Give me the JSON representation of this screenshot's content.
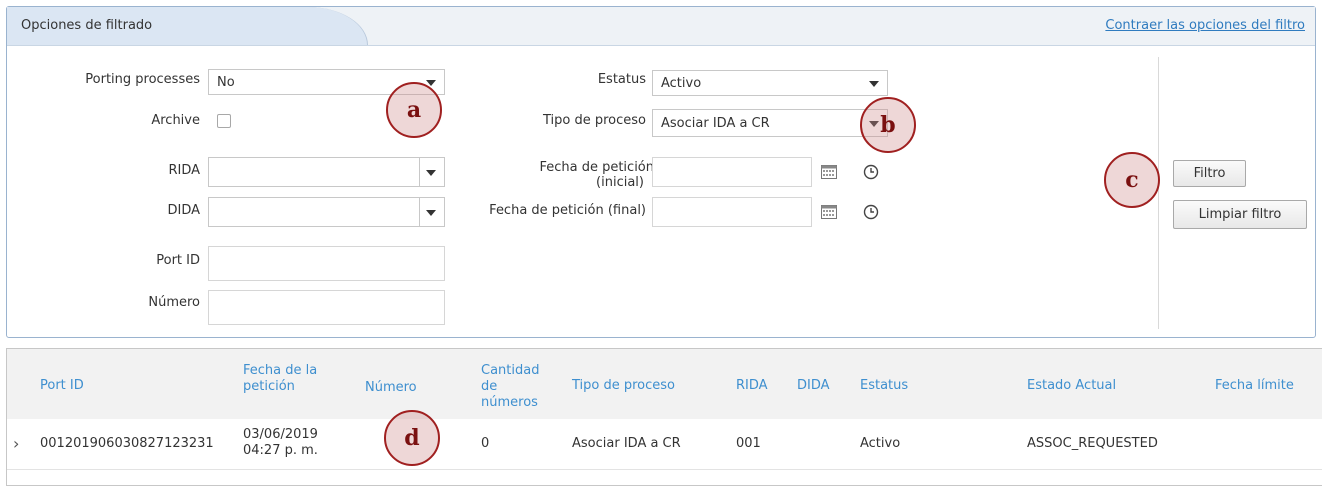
{
  "filter": {
    "title": "Opciones de filtrado",
    "collapse_link": "Contraer las opciones del filtro",
    "porting_processes": {
      "label": "Porting processes",
      "value": "No"
    },
    "archive": {
      "label": "Archive",
      "checked": false
    },
    "estatus": {
      "label": "Estatus",
      "value": "Activo"
    },
    "tipo_proceso": {
      "label": "Tipo de proceso",
      "value": "Asociar IDA a CR"
    },
    "rida": {
      "label": "RIDA",
      "value": ""
    },
    "dida": {
      "label": "DIDA",
      "value": ""
    },
    "fecha_inicial": {
      "label_line1": "Fecha de petición",
      "label_line2": "(inicial)",
      "value": ""
    },
    "fecha_final": {
      "label": "Fecha de petición (final)",
      "value": ""
    },
    "port_id": {
      "label": "Port ID",
      "value": ""
    },
    "numero": {
      "label": "Número",
      "value": ""
    },
    "buttons": {
      "filter": "Filtro",
      "clear": "Limpiar filtro"
    }
  },
  "markers": {
    "a": "a",
    "b": "b",
    "c": "c",
    "d": "d"
  },
  "grid": {
    "columns": [
      {
        "label_line1": "Port ID",
        "label_line2": "",
        "label_line3": ""
      },
      {
        "label_line1": "Fecha de la",
        "label_line2": "petición",
        "label_line3": ""
      },
      {
        "label_line1": "Número",
        "label_line2": "",
        "label_line3": ""
      },
      {
        "label_line1": "Cantidad",
        "label_line2": "de",
        "label_line3": "números"
      },
      {
        "label_line1": "Tipo de proceso",
        "label_line2": "",
        "label_line3": ""
      },
      {
        "label_line1": "RIDA",
        "label_line2": "",
        "label_line3": ""
      },
      {
        "label_line1": "DIDA",
        "label_line2": "",
        "label_line3": ""
      },
      {
        "label_line1": "Estatus",
        "label_line2": "",
        "label_line3": ""
      },
      {
        "label_line1": "Estado Actual",
        "label_line2": "",
        "label_line3": ""
      },
      {
        "label_line1": "Fecha límite",
        "label_line2": "",
        "label_line3": ""
      }
    ],
    "rows": [
      {
        "port_id": "001201906030827123231",
        "fecha_line1": "03/06/2019",
        "fecha_line2": "04:27 p. m.",
        "numero": "",
        "cantidad": "0",
        "tipo": "Asociar IDA a CR",
        "rida": "001",
        "dida": "",
        "estatus": "Activo",
        "estado_actual": "ASSOC_REQUESTED",
        "fecha_limite": ""
      }
    ]
  },
  "colors": {
    "link": "#2f7bbf",
    "header_text": "#3e8fcf",
    "marker_border": "#a02020"
  }
}
